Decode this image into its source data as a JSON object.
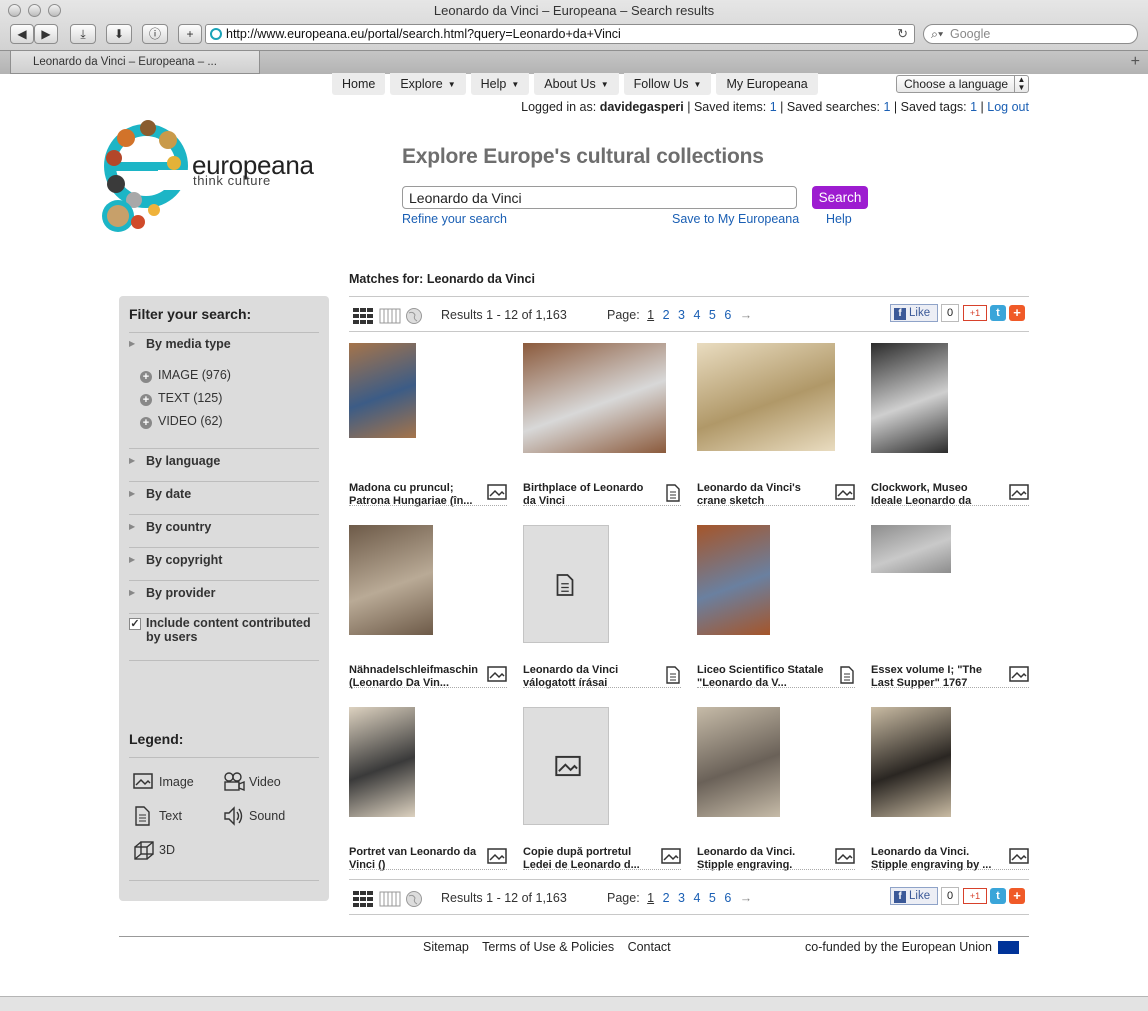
{
  "browser": {
    "window_title": "Leonardo da Vinci – Europeana – Search results",
    "url": "http://www.europeana.eu/portal/search.html?query=Leonardo+da+Vinci",
    "search_placeholder": "Google",
    "tab_title": "Leonardo da Vinci – Europeana – ..."
  },
  "nav": {
    "items": [
      "Home",
      "Explore",
      "Help",
      "About Us",
      "Follow Us",
      "My Europeana"
    ],
    "language_select": "Choose a language"
  },
  "user": {
    "logged_in_label": "Logged in as:",
    "username": "davidegasperi",
    "saved_items_label": "Saved items:",
    "saved_items": "1",
    "saved_searches_label": "Saved searches:",
    "saved_searches": "1",
    "saved_tags_label": "Saved tags:",
    "saved_tags": "1",
    "logout": "Log out"
  },
  "logo": {
    "word": "europeana",
    "tagline": "think culture"
  },
  "search": {
    "headline": "Explore Europe's cultural collections",
    "query": "Leonardo da Vinci",
    "button": "Search",
    "refine": "Refine your search",
    "save": "Save to My Europeana",
    "help": "Help"
  },
  "sidebar": {
    "filter_title": "Filter your search:",
    "sections": [
      "By media type",
      "By language",
      "By date",
      "By country",
      "By copyright",
      "By provider"
    ],
    "media_types": [
      "IMAGE (976)",
      "TEXT (125)",
      "VIDEO (62)"
    ],
    "include_ugc": "Include content contributed by users",
    "legend_title": "Legend:",
    "legend": [
      "Image",
      "Video",
      "Text",
      "Sound",
      "3D"
    ]
  },
  "results": {
    "matches_label": "Matches for:",
    "matches_query": "Leonardo da Vinci",
    "count": "Results 1 - 12 of 1,163",
    "page_label": "Page:",
    "pages": [
      "1",
      "2",
      "3",
      "4",
      "5",
      "6",
      "→"
    ],
    "like": "Like",
    "like_count": "0",
    "gplus": "+1",
    "items": [
      {
        "title": "Madona cu pruncul; Patrona Hungariae (în...",
        "type": "image"
      },
      {
        "title": "Birthplace of Leonardo da Vinci",
        "type": "text"
      },
      {
        "title": "Leonardo da Vinci's crane sketch",
        "type": "image"
      },
      {
        "title": "Clockwork, Museo Ideale Leonardo da",
        "type": "image"
      },
      {
        "title": "Nähnadelschleifmaschin (Leonardo Da Vin...",
        "type": "image"
      },
      {
        "title": "Leonardo da Vinci válogatott írásai",
        "type": "text"
      },
      {
        "title": "Liceo Scientifico Statale \"Leonardo da V...",
        "type": "text"
      },
      {
        "title": "Essex volume I; \"The Last Supper\" 1767",
        "type": "image"
      },
      {
        "title": "Portret van Leonardo da Vinci ()",
        "type": "image"
      },
      {
        "title": "Copie după portretul Ledei de Leonardo d...",
        "type": "image"
      },
      {
        "title": "Leonardo da Vinci. Stipple engraving.",
        "type": "image"
      },
      {
        "title": "Leonardo da Vinci. Stipple engraving by ...",
        "type": "image"
      }
    ]
  },
  "footer": {
    "links": [
      "Sitemap",
      "Terms of Use & Policies",
      "Contact"
    ],
    "eu": "co-funded by the European Union"
  },
  "colors": {
    "accent": "#9d1cd0",
    "link": "#1a5fb4",
    "sidebar_bg": "#dcdcdc"
  }
}
